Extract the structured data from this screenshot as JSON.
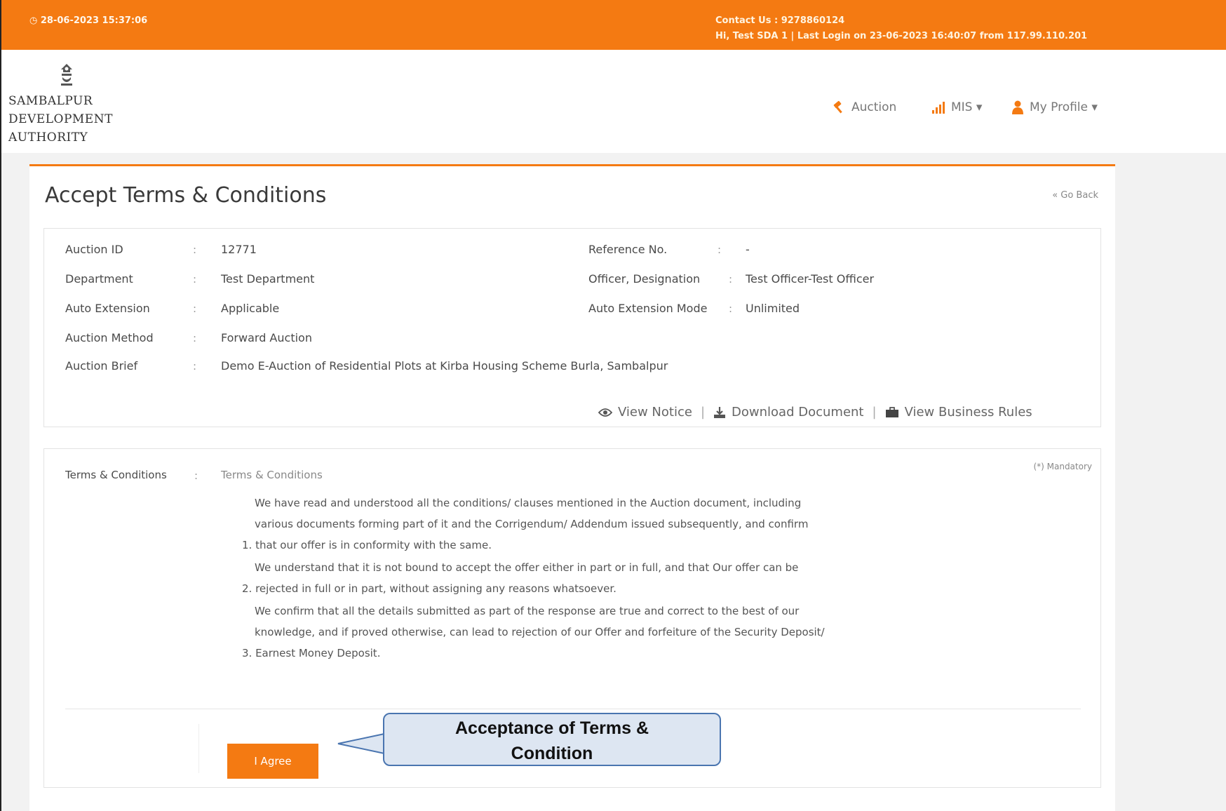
{
  "topbar": {
    "datetime": "◷ 28-06-2023 15:37:06",
    "contact": "Contact Us : 9278860124",
    "greeting": "Hi, Test SDA 1 | Last Login on 23-06-2023 16:40:07 from 117.99.110.201"
  },
  "header": {
    "org_line1": "SAMBALPUR",
    "org_line2": "DEVELOPMENT",
    "org_line3": "AUTHORITY",
    "nav": {
      "auction": "Auction",
      "mis": "MIS ▾",
      "profile": "My Profile ▾"
    }
  },
  "page": {
    "title": "Accept Terms & Conditions",
    "go_back": "« Go Back"
  },
  "details": {
    "auction_id_label": "Auction ID",
    "auction_id": "12771",
    "reference_label": "Reference No.",
    "reference": "-",
    "department_label": "Department",
    "department": "Test Department",
    "officer_label": "Officer, Designation",
    "officer": "Test Officer-Test Officer",
    "auto_ext_label": "Auto Extension",
    "auto_ext": "Applicable",
    "auto_ext_mode_label": "Auto Extension Mode",
    "auto_ext_mode": "Unlimited",
    "method_label": "Auction Method",
    "method": "Forward Auction",
    "brief_label": "Auction Brief",
    "brief": "Demo E-Auction of Residential Plots at Kirba Housing Scheme Burla, Sambalpur",
    "colon": ":"
  },
  "links": {
    "view_notice": "View Notice",
    "download_document": "Download Document",
    "view_business_rules": "View Business Rules",
    "sep": "|"
  },
  "terms": {
    "mandatory": "(*) Mandatory",
    "label": "Terms & Conditions",
    "heading": "Terms & Conditions",
    "line1": "We have read and understood all the conditions/ clauses mentioned in the Auction document, including",
    "line2": "various documents forming part of it and the Corrigendum/ Addendum issued subsequently, and confirm",
    "line3": "1. that our offer is in conformity with the same.",
    "line4": "We understand that it is not bound to accept the offer either in part or in full, and that Our offer can be",
    "line5": "2. rejected in full or in part, without assigning any reasons whatsoever.",
    "line6": "We confirm that all the details submitted as part of the response are true and correct to the best of our",
    "line7": "knowledge, and if proved otherwise, can lead to rejection of our Offer and forfeiture of the Security Deposit/",
    "line8": "3. Earnest Money Deposit."
  },
  "agree_button": "I Agree",
  "callout": {
    "line1": "Acceptance of Terms &",
    "line2": "Condition"
  },
  "colors": {
    "accent": "#f47a12",
    "callout_fill": "#dde6f2",
    "callout_border": "#4a75b0"
  }
}
